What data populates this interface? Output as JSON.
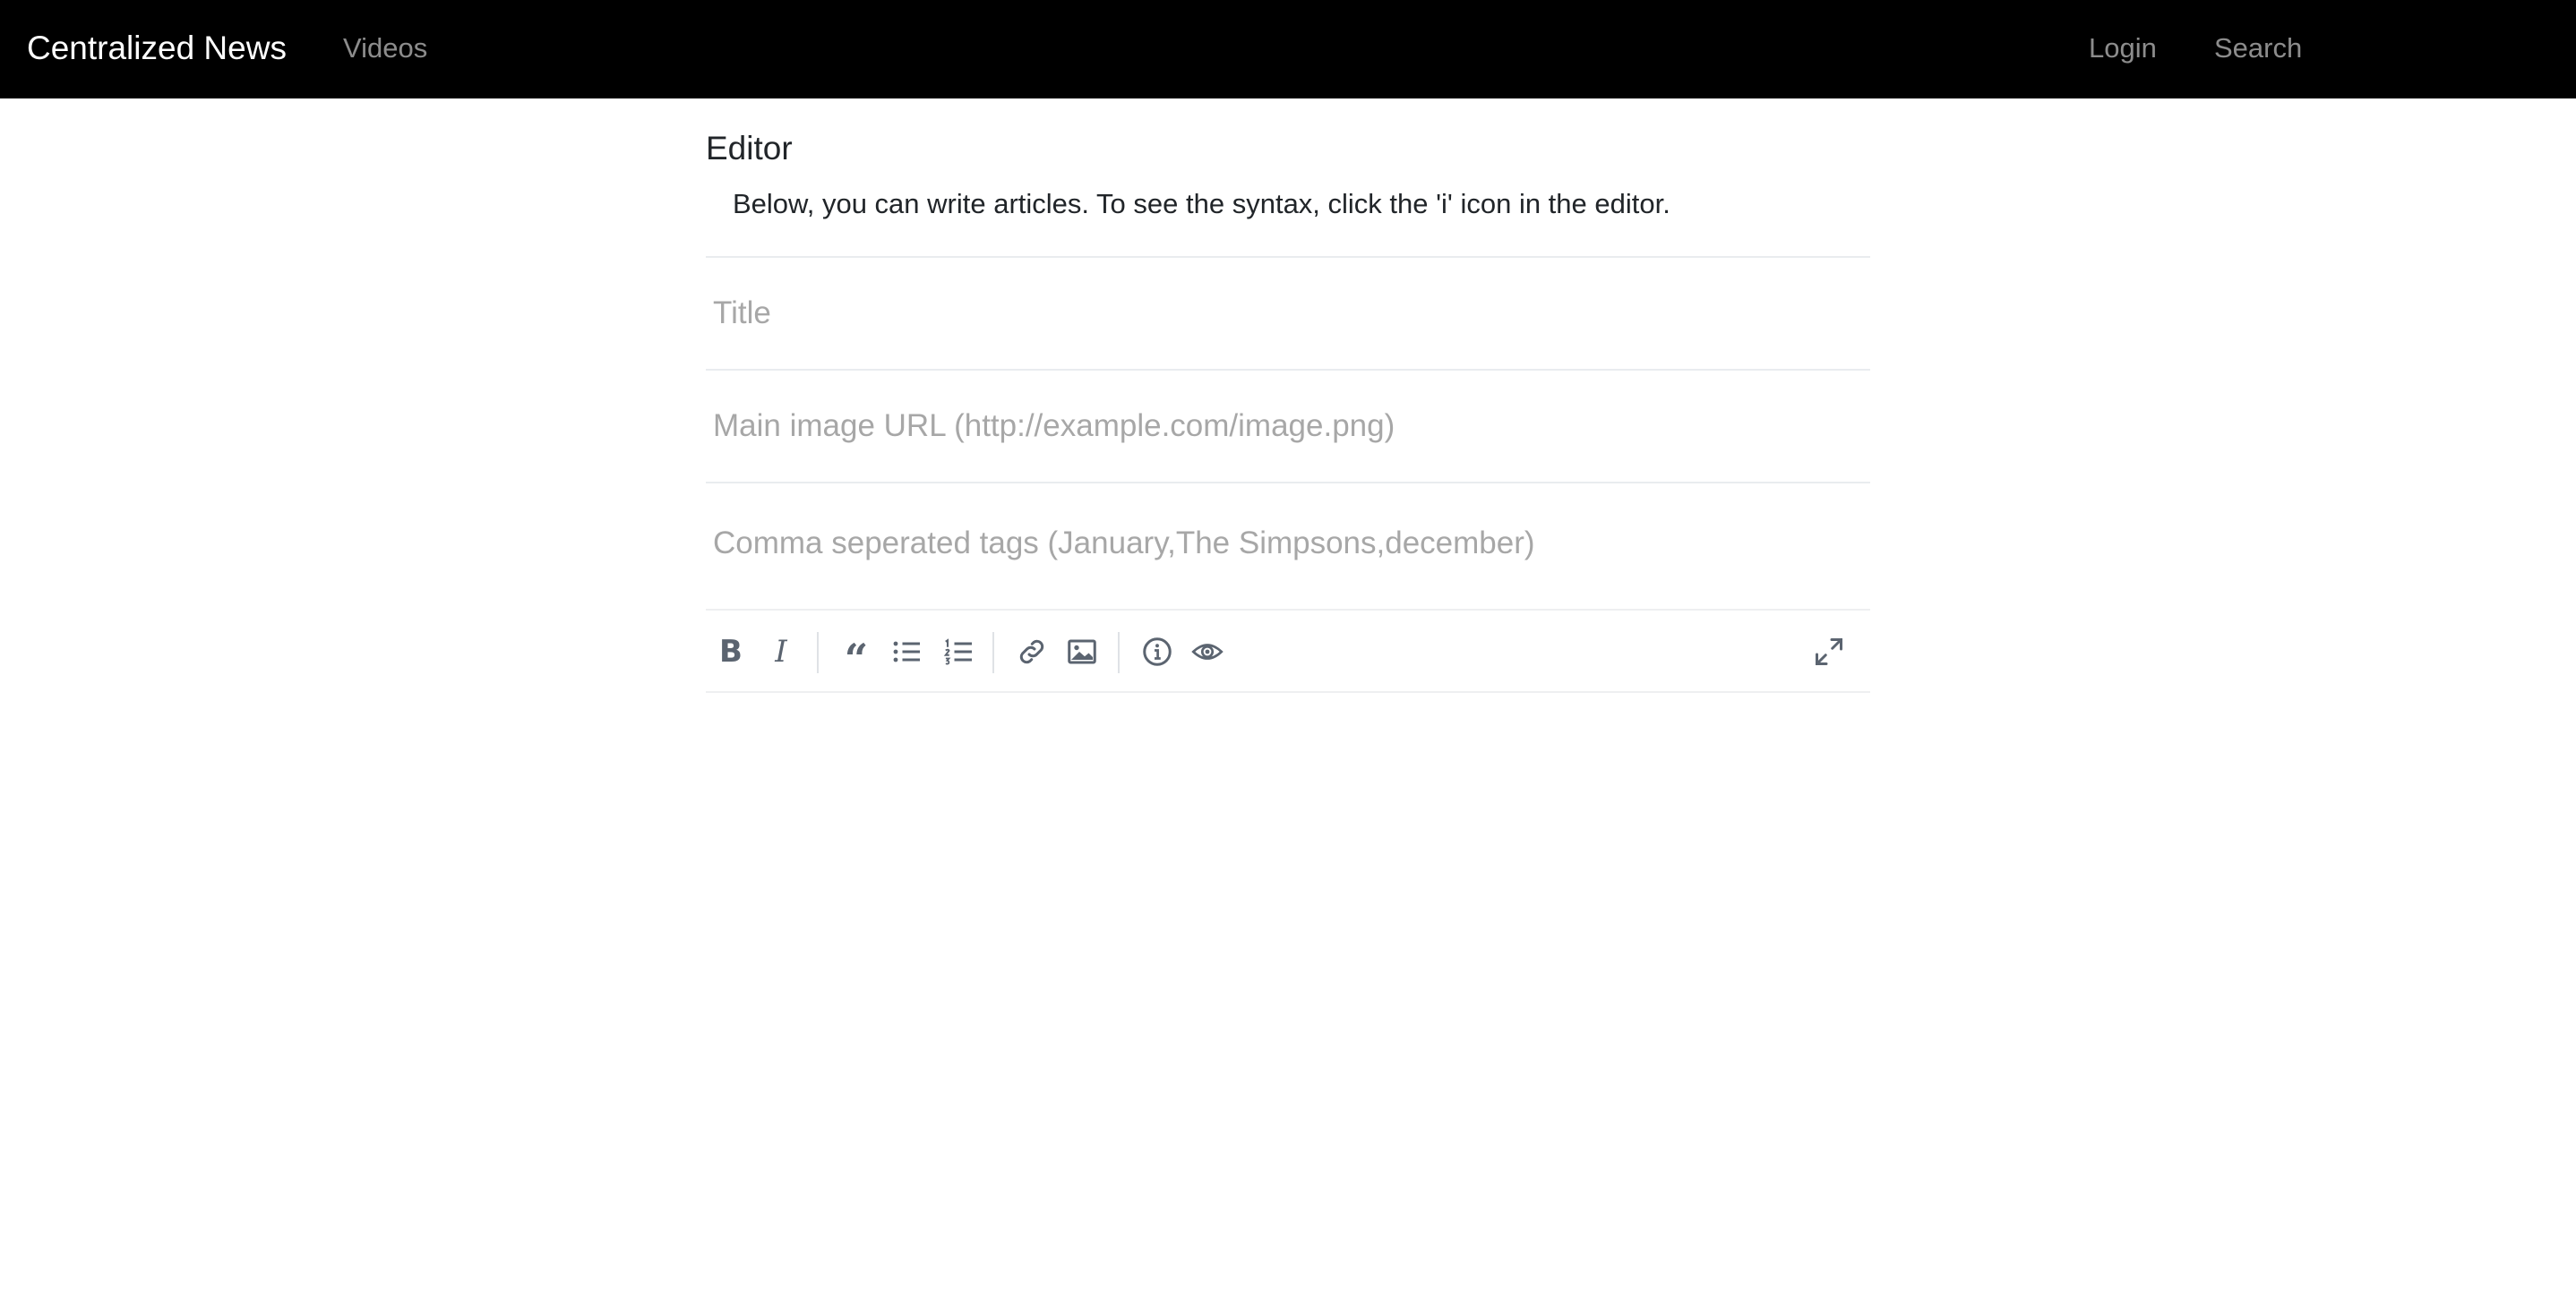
{
  "navbar": {
    "brand": "Centralized News",
    "videos_label": "Videos",
    "login_label": "Login",
    "search_placeholder": "Search"
  },
  "editor": {
    "heading": "Editor",
    "description": "Below, you can write articles. To see the syntax, click the 'i' icon in the editor.",
    "title_placeholder": "Title",
    "image_placeholder": "Main image URL (http://example.com/image.png)",
    "tags_placeholder": "Comma seperated tags (January,The Simpsons,december)"
  },
  "toolbar": {
    "bold_glyph": "B",
    "italic_glyph": "I",
    "quote_glyph": "“",
    "icons": [
      "bold-icon",
      "italic-icon",
      "quote-icon",
      "unordered-list-icon",
      "ordered-list-icon",
      "link-icon",
      "image-icon",
      "info-icon",
      "preview-eye-icon",
      "fullscreen-icon"
    ],
    "icon_color": "#5b6470"
  },
  "colors": {
    "navbar_bg": "#000000",
    "brand_text": "#ffffff",
    "nav_link": "rgba(255,255,255,0.55)",
    "placeholder": "#a7a7a7",
    "divider": "#e9ecef"
  }
}
